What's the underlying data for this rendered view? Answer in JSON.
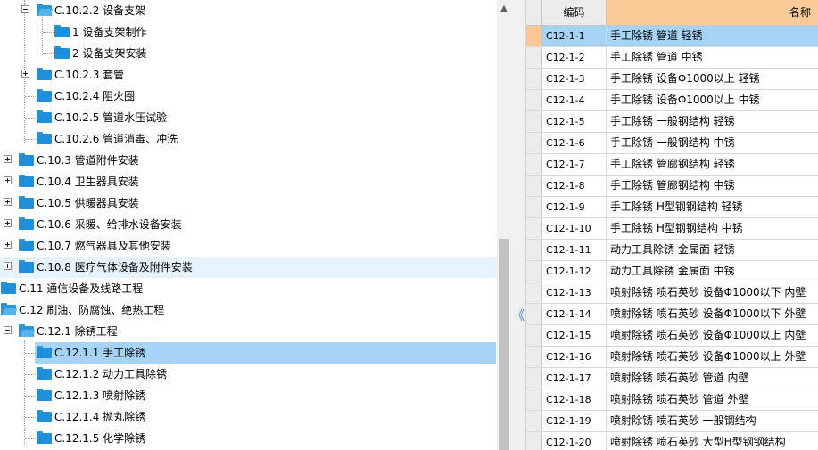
{
  "tree": {
    "nodes": [
      {
        "label": "C.10.2.2 设备支架",
        "level": 1,
        "expander": "minus",
        "folder": "open",
        "lineParent": true
      },
      {
        "label": "1 设备支架制作",
        "level": 2,
        "expander": "none",
        "folder": "closed"
      },
      {
        "label": "2 设备支架安装",
        "level": 2,
        "expander": "none",
        "folder": "closed"
      },
      {
        "label": "C.10.2.3 套管",
        "level": 1,
        "expander": "plus",
        "folder": "closed"
      },
      {
        "label": "C.10.2.4 阻火圈",
        "level": 1,
        "expander": "none",
        "folder": "closed"
      },
      {
        "label": "C.10.2.5 管道水压试验",
        "level": 1,
        "expander": "none",
        "folder": "closed"
      },
      {
        "label": "C.10.2.6 管道消毒、冲洗",
        "level": 1,
        "expander": "none",
        "folder": "closed"
      },
      {
        "label": "C.10.3 管道附件安装",
        "level": 0,
        "expander": "plus",
        "folder": "closed"
      },
      {
        "label": "C.10.4 卫生器具安装",
        "level": 0,
        "expander": "plus",
        "folder": "closed"
      },
      {
        "label": "C.10.5 供暖器具安装",
        "level": 0,
        "expander": "plus",
        "folder": "closed"
      },
      {
        "label": "C.10.6 采暖、给排水设备安装",
        "level": 0,
        "expander": "plus",
        "folder": "closed"
      },
      {
        "label": "C.10.7 燃气器具及其他安装",
        "level": 0,
        "expander": "plus",
        "folder": "closed"
      },
      {
        "label": "C.10.8 医疗气体设备及附件安装",
        "level": 0,
        "expander": "plus",
        "folder": "closed",
        "hover": true
      },
      {
        "label": "C.11 通信设备及线路工程",
        "level": -1,
        "expander": "none",
        "folder": "closed"
      },
      {
        "label": "C.12 刷油、防腐蚀、绝热工程",
        "level": -1,
        "expander": "none",
        "folder": "open"
      },
      {
        "label": "C.12.1 除锈工程",
        "level": 0,
        "expander": "minus",
        "folder": "open"
      },
      {
        "label": "C.12.1.1 手工除锈",
        "level": 1,
        "expander": "none",
        "folder": "closed",
        "selected": true
      },
      {
        "label": "C.12.1.2 动力工具除锈",
        "level": 1,
        "expander": "none",
        "folder": "closed"
      },
      {
        "label": "C.12.1.3 喷射除锈",
        "level": 1,
        "expander": "none",
        "folder": "closed"
      },
      {
        "label": "C.12.1.4 抛丸除锈",
        "level": 1,
        "expander": "none",
        "folder": "closed"
      },
      {
        "label": "C.12.1.5 化学除锈",
        "level": 1,
        "expander": "none",
        "folder": "closed"
      }
    ]
  },
  "scrollbar": {
    "up_arrow": "▲"
  },
  "splitter": {
    "collapse_glyph": "《"
  },
  "grid": {
    "columns": {
      "code": "编码",
      "name": "名称"
    },
    "selected_index": 0,
    "rows": [
      {
        "code": "C12-1-1",
        "name": "手工除锈 管道 轻锈"
      },
      {
        "code": "C12-1-2",
        "name": "手工除锈 管道 中锈"
      },
      {
        "code": "C12-1-3",
        "name": "手工除锈 设备Φ1000以上 轻锈"
      },
      {
        "code": "C12-1-4",
        "name": "手工除锈 设备Φ1000以上 中锈"
      },
      {
        "code": "C12-1-5",
        "name": "手工除锈 一般钢结构 轻锈"
      },
      {
        "code": "C12-1-6",
        "name": "手工除锈 一般钢结构 中锈"
      },
      {
        "code": "C12-1-7",
        "name": "手工除锈 管廊钢结构 轻锈"
      },
      {
        "code": "C12-1-8",
        "name": "手工除锈 管廊钢结构 中锈"
      },
      {
        "code": "C12-1-9",
        "name": "手工除锈 H型钢钢结构 轻锈"
      },
      {
        "code": "C12-1-10",
        "name": "手工除锈 H型钢钢结构 中锈"
      },
      {
        "code": "C12-1-11",
        "name": "动力工具除锈 金属面 轻锈"
      },
      {
        "code": "C12-1-12",
        "name": "动力工具除锈 金属面 中锈"
      },
      {
        "code": "C12-1-13",
        "name": "喷射除锈 喷石英砂 设备Φ1000以下 内壁"
      },
      {
        "code": "C12-1-14",
        "name": "喷射除锈 喷石英砂 设备Φ1000以下 外壁"
      },
      {
        "code": "C12-1-15",
        "name": "喷射除锈 喷石英砂 设备Φ1000以上 内壁"
      },
      {
        "code": "C12-1-16",
        "name": "喷射除锈 喷石英砂 设备Φ1000以上 外壁"
      },
      {
        "code": "C12-1-17",
        "name": "喷射除锈 喷石英砂 管道 内壁"
      },
      {
        "code": "C12-1-18",
        "name": "喷射除锈 喷石英砂 管道 外壁"
      },
      {
        "code": "C12-1-19",
        "name": "喷射除锈 喷石英砂 一般钢结构"
      },
      {
        "code": "C12-1-20",
        "name": "喷射除锈 喷石英砂 大型H型钢钢结构"
      }
    ]
  },
  "colors": {
    "selection": "#a5d4f7",
    "header_accent": "#f9cb96",
    "folder": "#1e8fdb",
    "hover": "#e6f2fc"
  }
}
